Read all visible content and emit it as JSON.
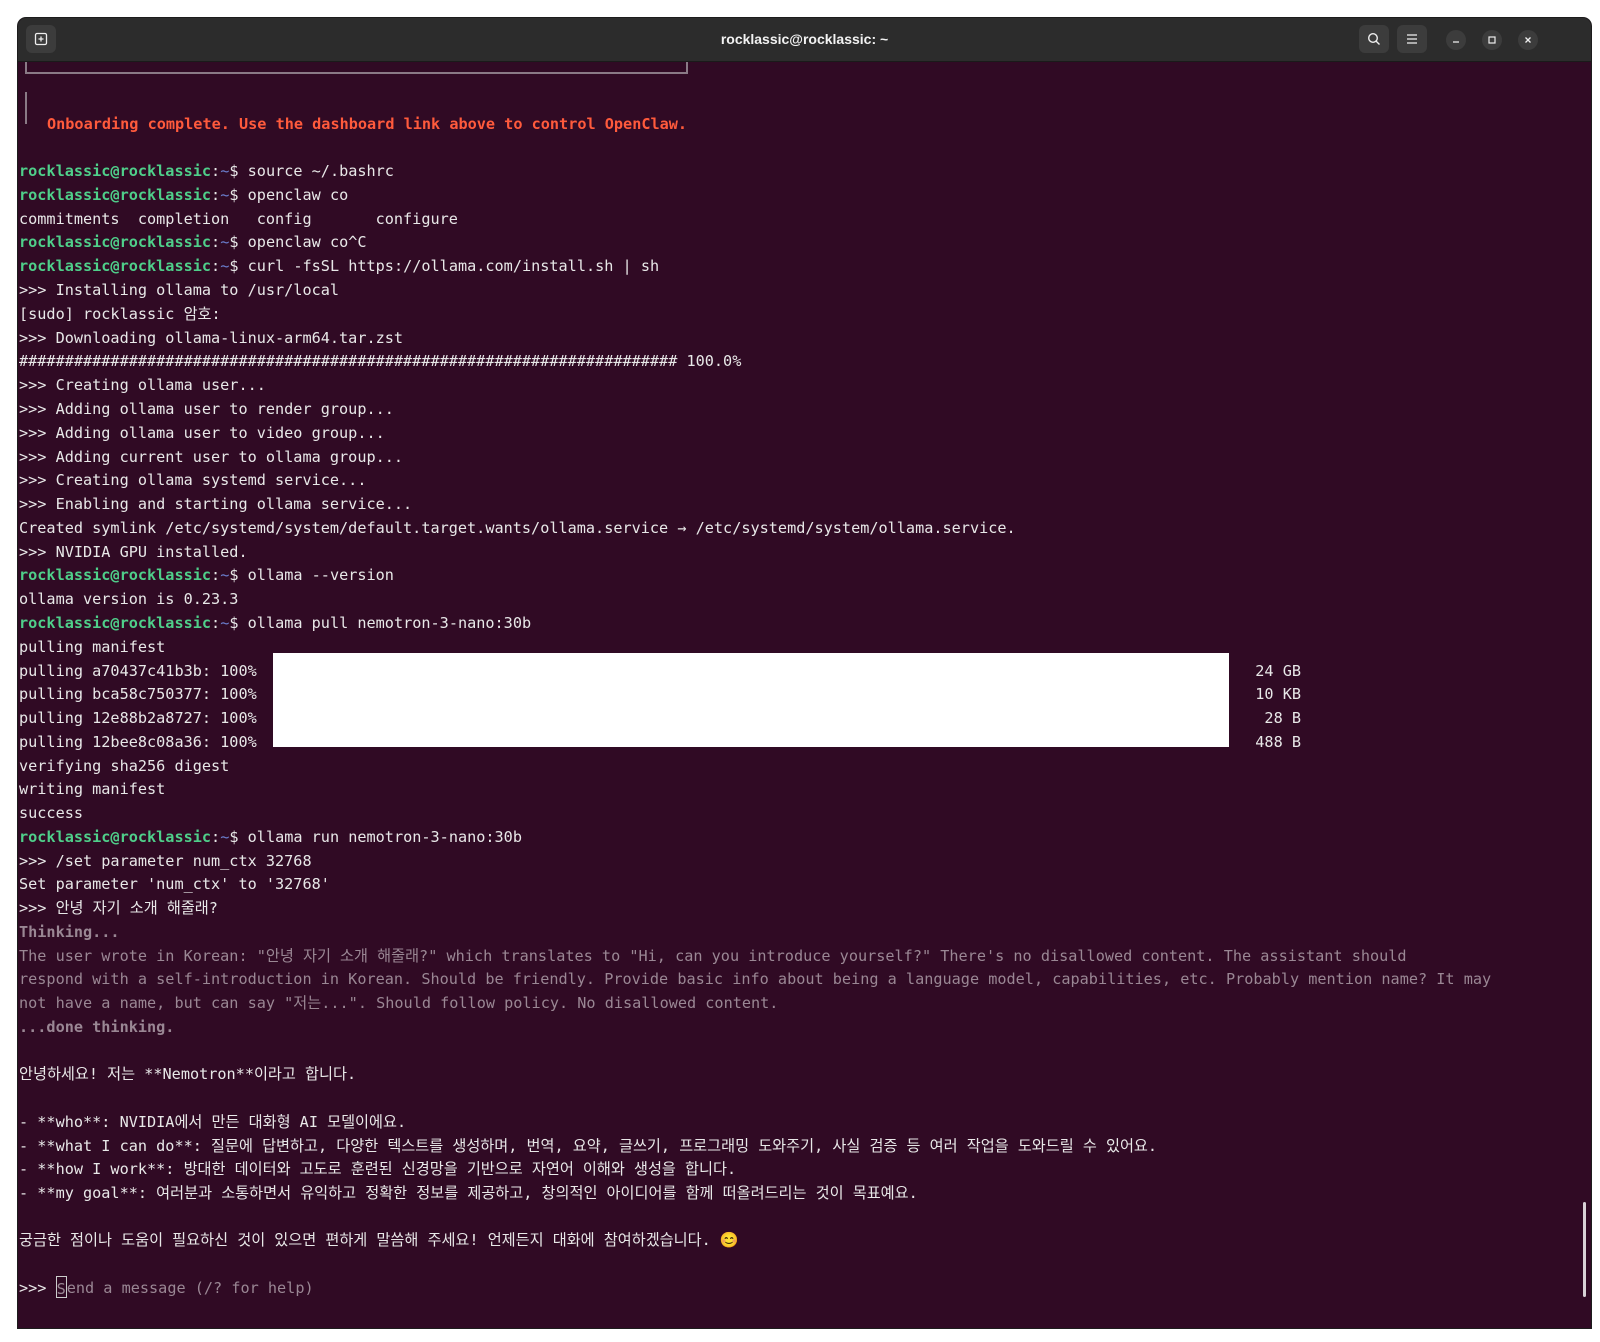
{
  "window": {
    "title": "rocklassic@rocklassic: ~"
  },
  "prompt": {
    "user_host": "rocklassic@rocklassic",
    "path": "~",
    "dollar": "$"
  },
  "onboarding": "Onboarding complete. Use the dashboard link above to control OpenClaw.",
  "cmd1": "source ~/.bashrc",
  "cmd2": "openclaw co",
  "completions": "commitments  completion   config       configure",
  "cmd3": "openclaw co^C",
  "cmd4": "curl -fsSL https://ollama.com/install.sh | sh",
  "install": [
    ">>> Installing ollama to /usr/local",
    "[sudo] rocklassic 암호:",
    ">>> Downloading ollama-linux-arm64.tar.zst",
    "######################################################################## 100.0%",
    ">>> Creating ollama user...",
    ">>> Adding ollama user to render group...",
    ">>> Adding ollama user to video group...",
    ">>> Adding current user to ollama group...",
    ">>> Creating ollama systemd service...",
    ">>> Enabling and starting ollama service...",
    "Created symlink /etc/systemd/system/default.target.wants/ollama.service → /etc/systemd/system/ollama.service.",
    ">>> NVIDIA GPU installed."
  ],
  "cmd5": "ollama --version",
  "version_out": "ollama version is 0.23.3",
  "cmd6": "ollama pull nemotron-3-nano:30b",
  "pull": {
    "manifest": "pulling manifest",
    "layers": [
      {
        "label": "pulling a70437c41b3b: 100%",
        "progress": 1.0,
        "size": "24 GB"
      },
      {
        "label": "pulling bca58c750377: 100%",
        "progress": 1.0,
        "size": "10 KB"
      },
      {
        "label": "pulling 12e88b2a8727: 100%",
        "progress": 1.0,
        "size": "28 B"
      },
      {
        "label": "pulling 12bee8c08a36: 100%",
        "progress": 1.0,
        "size": "488 B"
      }
    ],
    "verify": "verifying sha256 digest",
    "writing": "writing manifest",
    "success": "success"
  },
  "cmd7": "ollama run nemotron-3-nano:30b",
  "session": {
    "set_cmd": ">>> /set parameter num_ctx 32768",
    "set_out": "Set parameter 'num_ctx' to '32768'",
    "user_msg": ">>> 안녕 자기 소개 해줄래?",
    "thinking_start": "Thinking...",
    "thinking": [
      "The user wrote in Korean: \"안녕 자기 소개 해줄래?\" which translates to \"Hi, can you introduce yourself?\" There's no disallowed content. The assistant should",
      "respond with a self-introduction in Korean. Should be friendly. Provide basic info about being a language model, capabilities, etc. Probably mention name? It may",
      "not have a name, but can say \"저는...\". Should follow policy. No disallowed content."
    ],
    "thinking_end": "...done thinking.",
    "reply_intro": "안녕하세요! 저는 **Nemotron**이라고 합니다.",
    "reply_bullets": [
      "- **who**: NVIDIA에서 만든 대화형 AI 모델이에요.",
      "- **what I can do**: 질문에 답변하고, 다양한 텍스트를 생성하며, 번역, 요약, 글쓰기, 프로그래밍 도와주기, 사실 검증 등 여러 작업을 도와드릴 수 있어요.",
      "- **how I work**: 방대한 데이터와 고도로 훈련된 신경망을 기반으로 자연어 이해와 생성을 합니다.",
      "- **my goal**: 여러분과 소통하면서 유익하고 정확한 정보를 제공하고, 창의적인 아이디어를 함께 떠올려드리는 것이 목표예요."
    ],
    "reply_outro": "궁금한 점이나 도움이 필요하신 것이 있으면 편하게 말씀해 주세요! 언제든지 대화에 참여하겠습니다. 😊",
    "input_prefix": ">>> ",
    "input_placeholder_first": "S",
    "input_placeholder_rest": "end a message (/? for help)"
  },
  "icons": {
    "new_tab": "new-tab-icon",
    "search": "search-icon",
    "menu": "hamburger-menu-icon",
    "minimize": "minimize-icon",
    "maximize": "maximize-icon",
    "close": "close-icon"
  },
  "colors": {
    "terminal_bg": "#300a24",
    "prompt_green": "#4fcf8a",
    "onboarding_orange": "#ff5a3c",
    "thinking_grey": "#9a8794"
  }
}
